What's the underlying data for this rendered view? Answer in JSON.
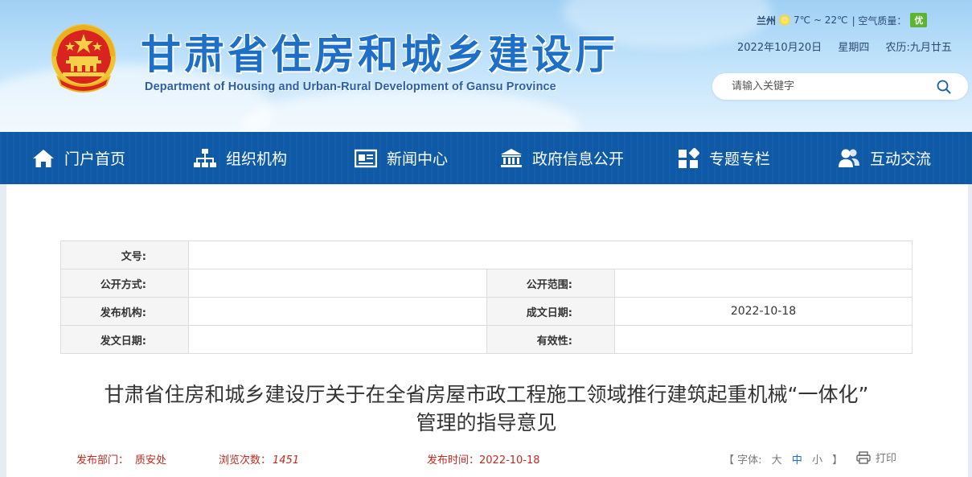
{
  "header": {
    "title": "甘肃省住房和城乡建设厅",
    "subtitle": "Department of Housing and Urban-Rural Development of Gansu Province",
    "weather": {
      "city": "兰州",
      "temperature": "7℃ ~ 22℃",
      "air_label": "| 空气质量：",
      "air_quality": "优"
    },
    "date": {
      "gregorian": "2022年10月20日",
      "weekday": "星期四",
      "lunar": "农历:九月廿五"
    },
    "search": {
      "placeholder": "请输入关键字"
    }
  },
  "nav": {
    "items": [
      {
        "label": "门户首页",
        "icon": "home-icon"
      },
      {
        "label": "组织机构",
        "icon": "org-chart-icon"
      },
      {
        "label": "新闻中心",
        "icon": "news-icon"
      },
      {
        "label": "政府信息公开",
        "icon": "government-icon"
      },
      {
        "label": "专题专栏",
        "icon": "grid-icon"
      },
      {
        "label": "互动交流",
        "icon": "users-icon"
      }
    ]
  },
  "meta": {
    "doc_number_label": "文号:",
    "doc_number": "",
    "disclosure_mode_label": "公开方式:",
    "disclosure_mode": "",
    "disclosure_scope_label": "公开范围:",
    "disclosure_scope": "",
    "issuer_label": "发布机构:",
    "issuer": "",
    "written_date_label": "成文日期:",
    "written_date": "2022-10-18",
    "issue_date_label": "发文日期:",
    "issue_date": "",
    "validity_label": "有效性:",
    "validity": ""
  },
  "article": {
    "title_line1": "甘肃省住房和城乡建设厅关于在全省房屋市政工程施工领域推行建筑起重机械“一体化”",
    "title_line2": "管理的指导意见",
    "dept_label": "发布部门：",
    "dept": "质安处",
    "views_label": "浏览次数：",
    "views": "1451",
    "time_label": "发布时间：",
    "time": "2022-10-18",
    "font_label": "【 字体:",
    "font_large": "大",
    "font_medium": "中",
    "font_small": "小",
    "font_close": "】",
    "print_label": "打印"
  }
}
